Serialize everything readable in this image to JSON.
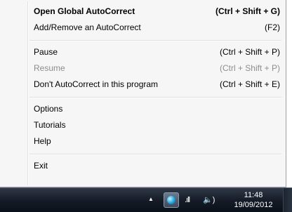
{
  "menu": {
    "items": [
      {
        "label": "Open Global AutoCorrect",
        "shortcut": "(Ctrl + Shift + G)"
      },
      {
        "label": "Add/Remove an AutoCorrect",
        "shortcut": "(F2)"
      },
      {
        "label": "Pause",
        "shortcut": "(Ctrl + Shift + P)"
      },
      {
        "label": "Resume",
        "shortcut": "(Ctrl + Shift + P)"
      },
      {
        "label": "Don't AutoCorrect in this program",
        "shortcut": "(Ctrl + Shift + E)"
      },
      {
        "label": "Options",
        "shortcut": ""
      },
      {
        "label": "Tutorials",
        "shortcut": ""
      },
      {
        "label": "Help",
        "shortcut": ""
      },
      {
        "label": "Exit",
        "shortcut": ""
      }
    ]
  },
  "taskbar": {
    "clock_time": "11:48",
    "clock_date": "19/09/2012",
    "icons": {
      "show_hidden": "▲",
      "signal": ".ıll",
      "volume": "🔈)"
    }
  }
}
